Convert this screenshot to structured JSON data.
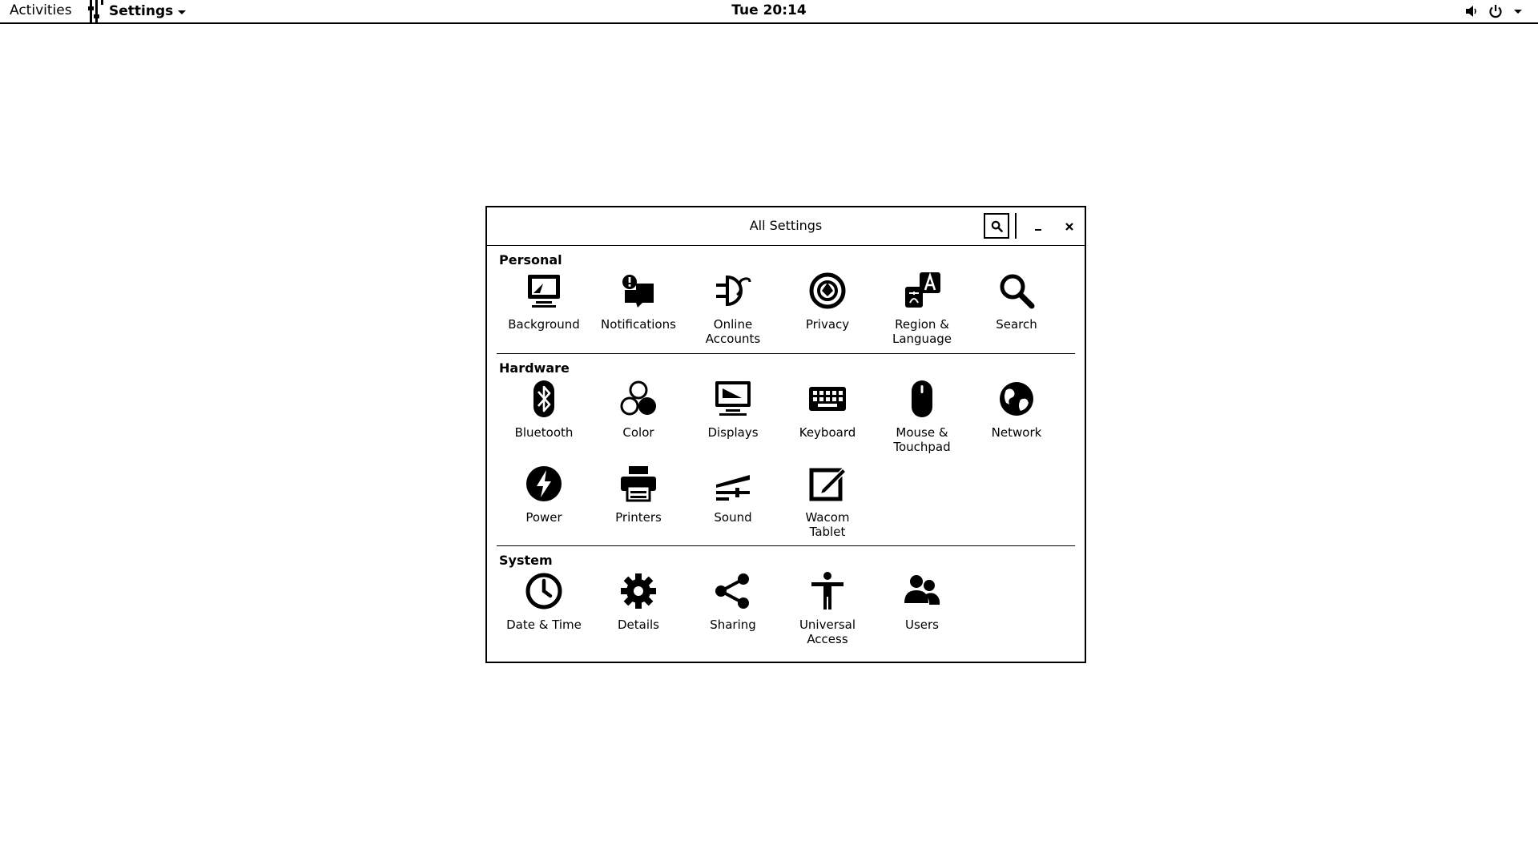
{
  "topbar": {
    "activities": "Activities",
    "app_name": "Settings",
    "clock": "Tue 20:14",
    "icons": [
      "settings-app-icon",
      "chevron-down-icon",
      "volume-icon",
      "power-icon"
    ]
  },
  "window": {
    "title": "All Settings",
    "buttons": [
      "search-icon",
      "minimize-icon",
      "close-icon"
    ]
  },
  "sections": {
    "personal": {
      "title": "Personal",
      "items": [
        {
          "label": "Background",
          "icon": "background-icon"
        },
        {
          "label": "Notifications",
          "icon": "notifications-icon"
        },
        {
          "label": "Online\nAccounts",
          "icon": "online-accounts-icon"
        },
        {
          "label": "Privacy",
          "icon": "privacy-icon"
        },
        {
          "label": "Region &\nLanguage",
          "icon": "region-language-icon"
        },
        {
          "label": "Search",
          "icon": "search-icon"
        }
      ]
    },
    "hardware": {
      "title": "Hardware",
      "items": [
        {
          "label": "Bluetooth",
          "icon": "bluetooth-icon"
        },
        {
          "label": "Color",
          "icon": "color-icon"
        },
        {
          "label": "Displays",
          "icon": "displays-icon"
        },
        {
          "label": "Keyboard",
          "icon": "keyboard-icon"
        },
        {
          "label": "Mouse &\nTouchpad",
          "icon": "mouse-icon"
        },
        {
          "label": "Network",
          "icon": "network-icon"
        },
        {
          "label": "Power",
          "icon": "power-icon"
        },
        {
          "label": "Printers",
          "icon": "printer-icon"
        },
        {
          "label": "Sound",
          "icon": "sound-icon"
        },
        {
          "label": "Wacom\nTablet",
          "icon": "wacom-tablet-icon"
        }
      ]
    },
    "system": {
      "title": "System",
      "items": [
        {
          "label": "Date & Time",
          "icon": "clock-icon"
        },
        {
          "label": "Details",
          "icon": "gear-icon"
        },
        {
          "label": "Sharing",
          "icon": "share-icon"
        },
        {
          "label": "Universal\nAccess",
          "icon": "accessibility-icon"
        },
        {
          "label": "Users",
          "icon": "users-icon"
        }
      ]
    }
  }
}
